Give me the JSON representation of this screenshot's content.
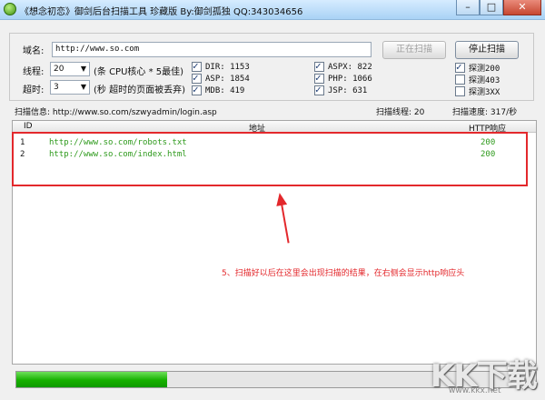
{
  "window": {
    "title": "《想念初恋》御剑后台扫描工具 珍藏版 By:御剑孤独 QQ:343034656",
    "buttons": {
      "minimize": "–",
      "maximize": "□",
      "close": "✕"
    }
  },
  "form": {
    "domain_label": "域名:",
    "domain_value": "http://www.so.com",
    "threads_label": "线程:",
    "threads_value": "20",
    "threads_hint": "(条 CPU核心 * 5最佳)",
    "timeout_label": "超时:",
    "timeout_value": "3",
    "timeout_hint": "(秒 超时的页面被丢弃)",
    "start_button": "正在扫描",
    "stop_button": "停止扫描",
    "dict": [
      {
        "label": "DIR: 1153",
        "checked": true
      },
      {
        "label": "ASP: 1854",
        "checked": true
      },
      {
        "label": "MDB: 419",
        "checked": true
      },
      {
        "label": "ASPX: 822",
        "checked": true
      },
      {
        "label": "PHP: 1066",
        "checked": true
      },
      {
        "label": "JSP: 631",
        "checked": true
      }
    ],
    "probes": [
      {
        "label": "探测200",
        "checked": true
      },
      {
        "label": "探测403",
        "checked": false
      },
      {
        "label": "探测3XX",
        "checked": false
      }
    ]
  },
  "info": {
    "scan_info": "扫描信息: http://www.so.com/szwyadmin/login.asp",
    "scan_threads": "扫描线程: 20",
    "scan_speed": "扫描速度: 317/秒"
  },
  "table": {
    "headers": {
      "id": "ID",
      "url": "地址",
      "status": "HTTP响应"
    },
    "rows": [
      {
        "id": "1",
        "url": "http://www.so.com/robots.txt",
        "status": "200"
      },
      {
        "id": "2",
        "url": "http://www.so.com/index.html",
        "status": "200"
      }
    ]
  },
  "annotation": "5、扫描好以后在这里会出现扫描的结果，在右侧会显示http响应头",
  "progress": {
    "fraction": 0.29
  },
  "watermark": {
    "logo": "KK下载",
    "url": "www.kkx.net"
  },
  "colors": {
    "accent_red": "#e3282c",
    "url_green": "#2e9a1c",
    "progress_green": "#16b000"
  }
}
